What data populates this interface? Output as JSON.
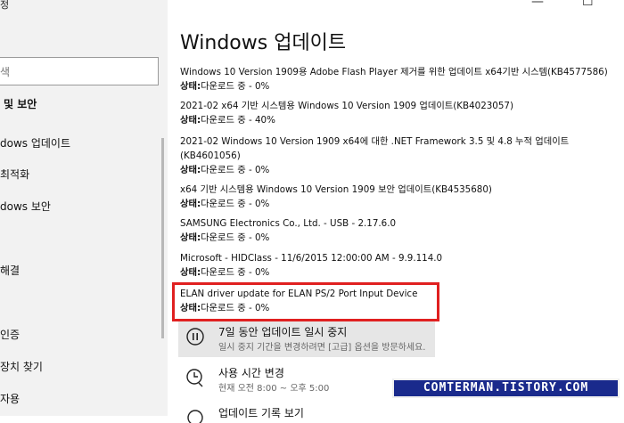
{
  "sidebar": {
    "top_char": "정",
    "search_placeholder": "색",
    "section_title": "및 보안",
    "items": [
      {
        "label": "dows 업데이트"
      },
      {
        "label": "최적화"
      },
      {
        "label": "dows 보안"
      },
      {
        "label": ""
      },
      {
        "label": "해결"
      },
      {
        "label": ""
      },
      {
        "label": "인증"
      },
      {
        "label": "장치 찾기"
      },
      {
        "label": "자용"
      }
    ]
  },
  "window_controls": {
    "minimize": "—",
    "maximize": "☐"
  },
  "page_title": "Windows 업데이트",
  "updates": [
    {
      "name": "Windows 10 Version 1909용 Adobe Flash Player 제거를 위한 업데이트 x64기반 시스템(KB4577586)",
      "status_label": "상태:",
      "status_value": "다운로드 중 - 0%"
    },
    {
      "name": "2021-02 x64 기반 시스템용 Windows 10 Version 1909 업데이트(KB4023057)",
      "status_label": "상태:",
      "status_value": "다운로드 중 - 40%"
    },
    {
      "name": "2021-02 Windows 10 Version 1909 x64에 대한 .NET Framework 3.5 및 4.8 누적 업데이트 (KB4601056)",
      "status_label": "상태:",
      "status_value": "다운로드 중 - 0%"
    },
    {
      "name": "x64 기반 시스템용 Windows 10 Version 1909 보안 업데이트(KB4535680)",
      "status_label": "상태:",
      "status_value": "다운로드 중 - 0%"
    },
    {
      "name": "SAMSUNG Electronics Co., Ltd.  - USB - 2.17.6.0",
      "status_label": "상태:",
      "status_value": "다운로드 중 - 0%"
    },
    {
      "name": "Microsoft - HIDClass - 11/6/2015 12:00:00 AM - 9.9.114.0",
      "status_label": "상태:",
      "status_value": "다운로드 중 - 0%"
    },
    {
      "name": "ELAN driver update for ELAN PS/2 Port Input Device",
      "status_label": "상태:",
      "status_value": "다운로드 중 - 0%"
    }
  ],
  "actions": {
    "pause": {
      "title": "7일 동안 업데이트 일시 중지",
      "subtitle": "일시 중지 기간을 변경하려면 [고급] 옵션을 방문하세요."
    },
    "active_hours": {
      "title": "사용 시간 변경",
      "subtitle": "현재 오전 8:00 ~ 오후 5:00"
    },
    "history": {
      "title": "업데이트 기록 보기"
    }
  },
  "watermark": "COMTERMAN.TISTORY.COM",
  "colors": {
    "highlight": "#e02020",
    "watermark_bg": "#1a2a8c"
  }
}
